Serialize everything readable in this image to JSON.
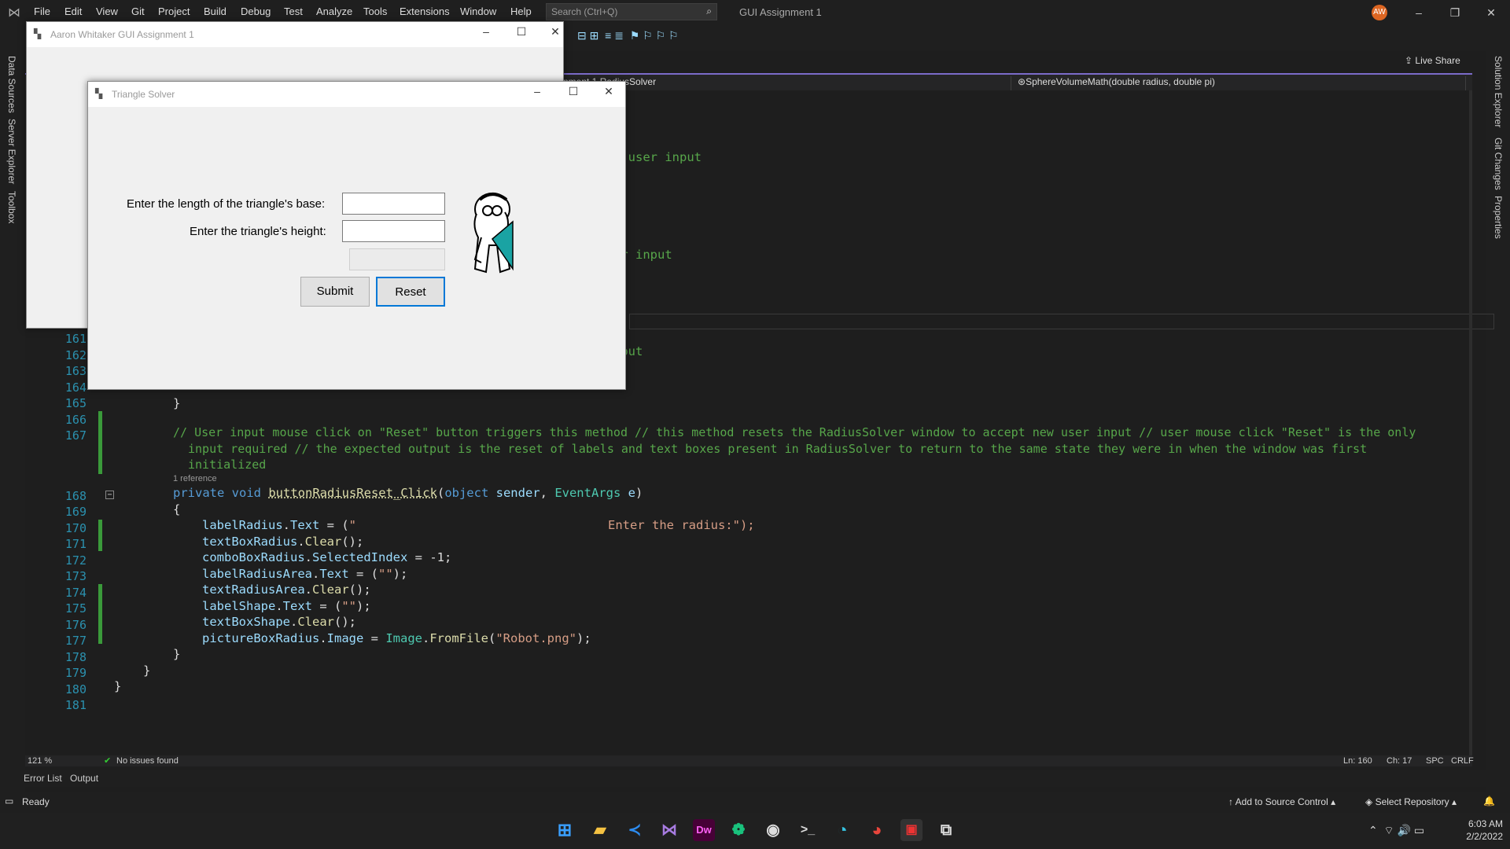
{
  "menu": [
    "File",
    "Edit",
    "View",
    "Git",
    "Project",
    "Build",
    "Debug",
    "Test",
    "Analyze",
    "Tools",
    "Extensions",
    "Window",
    "Help"
  ],
  "search": {
    "placeholder": "Search (Ctrl+Q)"
  },
  "vs_title": "GUI Assignment 1",
  "avatar": "AW",
  "live_share": "Live Share",
  "left_tabs": [
    "Data Sources",
    "Server Explorer",
    "Toolbox"
  ],
  "right_tabs": [
    "Solution Explorer",
    "Git Changes",
    "Properties"
  ],
  "nav": {
    "class": "nment 1.RadiusSolver",
    "member": "SphereVolumeMath(double radius, double pi)"
  },
  "visible_code_frag": {
    "a": ");",
    "b": "d user input",
    "c": "er input",
    "d": "nput"
  },
  "line_numbers": [
    "161",
    "162",
    "163",
    "164",
    "165",
    "166",
    "167",
    "168",
    "169",
    "170",
    "171",
    "172",
    "173",
    "174",
    "175",
    "176",
    "177",
    "178",
    "179",
    "180",
    "181"
  ],
  "code": {
    "l165": "}",
    "c1": "// User input mouse click on \"Reset\" button triggers this method // this method resets the RadiusSolver window to accept new user input // user mouse click \"Reset\" is the only",
    "c2": "input required // the expected output is the reset of labels and text boxes present in RadiusSolver to return to the same state they were in when the window was first",
    "c3": "initialized",
    "ref": "1 reference",
    "l170_str": "Enter the radius:\");"
  },
  "editor_status": {
    "zoom": "121 %",
    "issues": "No issues found",
    "ln": "Ln: 160",
    "ch": "Ch: 17",
    "spc": "SPC",
    "crlf": "CRLF"
  },
  "error_tabs": [
    "Error List",
    "Output"
  ],
  "status": {
    "ready": "Ready",
    "source_control": "Add to Source Control",
    "repo": "Select Repository"
  },
  "clock": {
    "time": "6:03 AM",
    "date": "2/2/2022"
  },
  "main_form": {
    "title": "Aaron Whitaker GUI Assignment 1"
  },
  "tri_form": {
    "title": "Triangle Solver",
    "base_label": "Enter the length of the triangle's base:",
    "height_label": "Enter the triangle's height:",
    "submit": "Submit",
    "reset": "Reset"
  },
  "taskbar": [
    "windows-start",
    "file-explorer",
    "vscode",
    "visual-studio",
    "dreamweaver",
    "chatgpt",
    "github-desktop",
    "terminal",
    "edge",
    "chrome",
    "app-active",
    "task-view"
  ]
}
